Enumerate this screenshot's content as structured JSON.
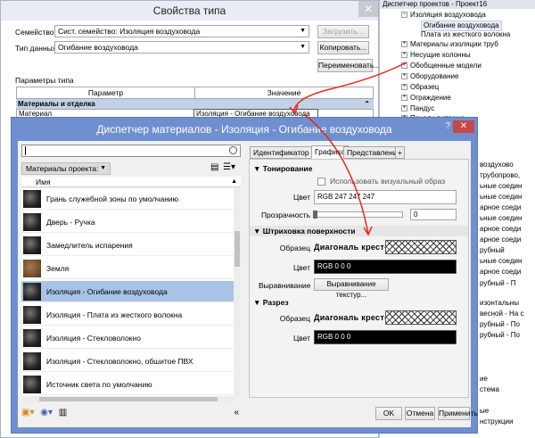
{
  "type_dialog": {
    "title": "Свойства типа",
    "family_label": "Семейство:",
    "family_value": "Сист. семейство: Изоляция воздуховода",
    "load_btn": "Загрузить...",
    "type_label": "Тип данных:",
    "type_value": "Огибание воздуховода",
    "copy_btn": "Копировать...",
    "rename_btn": "Переименовать...",
    "params_label": "Параметры типа",
    "col_param": "Параметр",
    "col_value": "Значение",
    "group_name": "Материалы и отделка",
    "row_param": "Материал",
    "row_value": "Изоляция - Огибание воздуховода"
  },
  "project_browser": {
    "title": "Диспетчер проектов - Проект16",
    "items": [
      "Изоляция воздуховода",
      "Огибание воздуховода",
      "Плата из жесткого волокна",
      "Материалы изоляции труб",
      "Несущие колонны",
      "Обобщенные модели",
      "Оборудование",
      "Образец",
      "Ограждение",
      "Пандус",
      "Панели витража"
    ],
    "right_fragments": [
      "воздухово",
      "трубопрово,",
      "ьные соедин",
      "ьные соедин",
      "арное соеди",
      "ьные соедин",
      "арное соеди",
      "арное соеди",
      "рубный",
      "ьные соедин",
      "арное соеди",
      "рубный - П",
      "изонтальны",
      "весной - На с",
      "рубный - По",
      "рубный - По",
      "ие",
      "стема",
      "ые",
      "нструкции"
    ]
  },
  "material_manager": {
    "title": "Диспетчер материалов - Изоляция - Огибание воздуховода",
    "help": "?",
    "search_placeholder": "",
    "library_label": "Материалы проекта: все",
    "column_name": "Имя",
    "materials": [
      "Грань служебной зоны по умолчанию",
      "Дверь - Ручка",
      "Замедлитель испарения",
      "Земля",
      "Изоляция - Огибание воздуховода",
      "Изоляция - Плата из жесткого волокна",
      "Изоляция - Стекловолокно",
      "Изоляция - Стекловолокно, обшитое ПВХ",
      "Источник света по умолчанию"
    ],
    "tabs": [
      "Идентификатор",
      "Графика",
      "Представление",
      "+"
    ],
    "shading": {
      "header": "Тонирование",
      "checkbox_label": "Использовать визуальный образ",
      "color_label": "Цвет",
      "color_value": "RGB 247 247 247",
      "transparency_label": "Прозрачность",
      "transparency_value": "0"
    },
    "surface": {
      "header": "Штриховка поверхности",
      "pattern_label": "Образец",
      "pattern_name": "Диагональ крест-...",
      "color_label": "Цвет",
      "color_value": "RGB 0 0 0",
      "align_label": "Выравнивание",
      "align_btn": "Выравнивание текстур..."
    },
    "cut": {
      "header": "Разрез",
      "pattern_label": "Образец",
      "pattern_name": "Диагональ крест-...",
      "color_label": "Цвет",
      "color_value": "RGB 0 0 0"
    },
    "ok": "OK",
    "cancel": "Отмена",
    "apply": "Применить"
  },
  "colors": {
    "dialog_frame": "#6f8fd0",
    "selection": "#a8c3e6",
    "annotation_red": "#e8261c"
  }
}
